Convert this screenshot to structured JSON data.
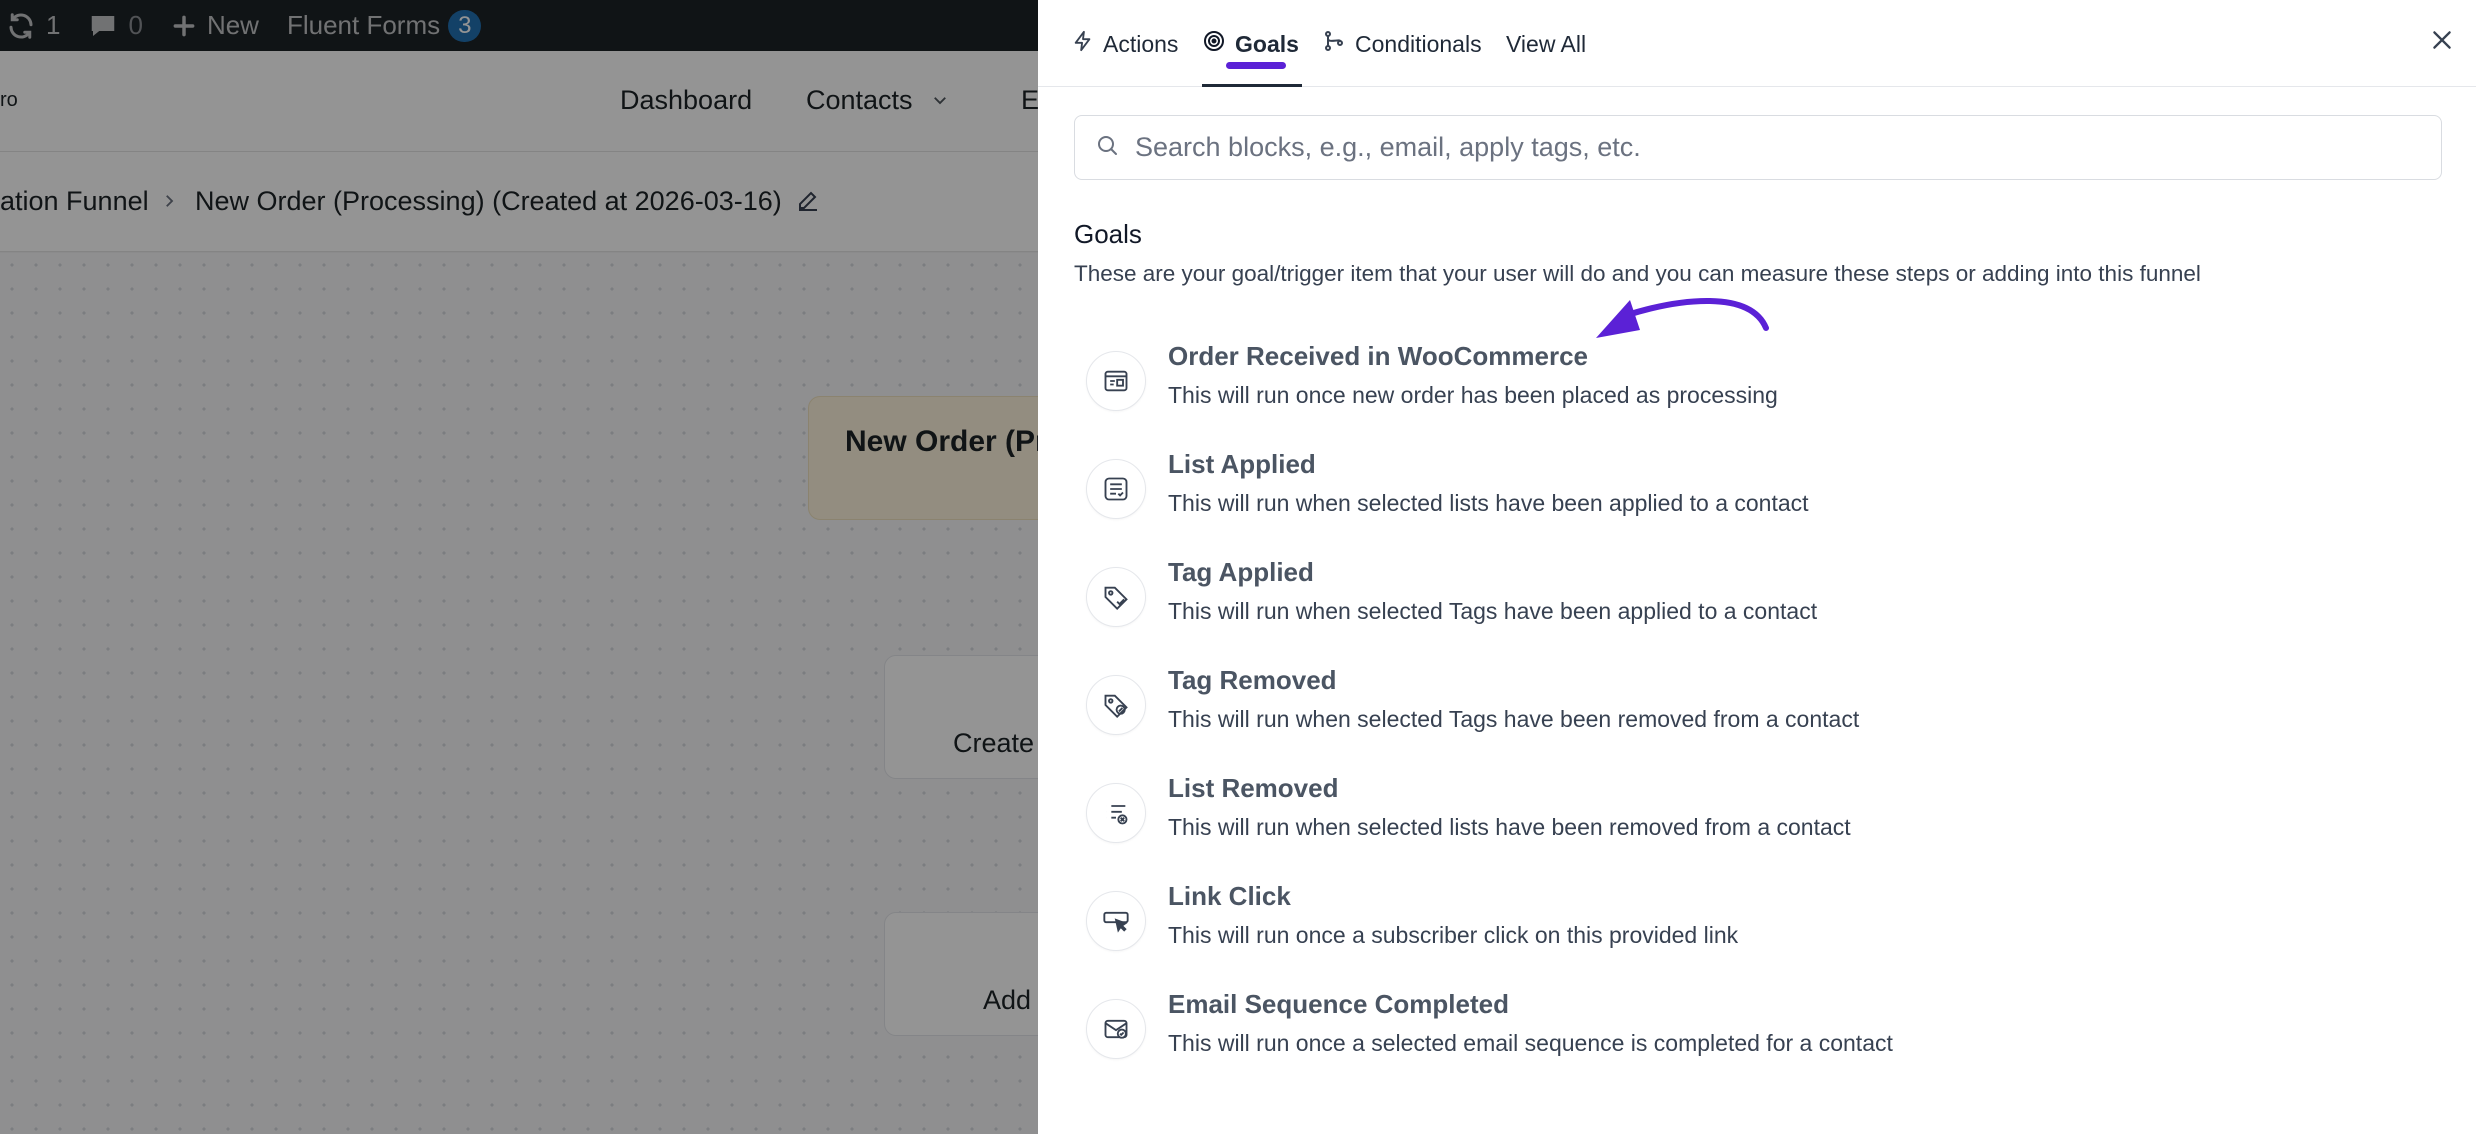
{
  "admin_bar": {
    "updates_count": "1",
    "comments_count": "0",
    "new_label": "New",
    "plugin_label": "Fluent Forms",
    "plugin_badge": "3"
  },
  "app": {
    "brand_fragment": "ro",
    "nav": {
      "dashboard": "Dashboard",
      "contacts": "Contacts",
      "partial": "E"
    },
    "breadcrumb": {
      "parent": "ation Funnel",
      "current": "New Order (Processing) (Created at 2026-03-16)"
    },
    "canvas": {
      "trigger_node": "New Order (Pr",
      "step_1": "Create",
      "step_2": "Add"
    }
  },
  "drawer": {
    "tabs": [
      {
        "label": "Actions",
        "icon": "lightning-icon"
      },
      {
        "label": "Goals",
        "icon": "target-icon",
        "active": true
      },
      {
        "label": "Conditionals",
        "icon": "branch-icon"
      },
      {
        "label": "View All"
      }
    ],
    "search": {
      "placeholder": "Search blocks, e.g., email, apply tags, etc.",
      "value": ""
    },
    "section": {
      "title": "Goals",
      "description": "These are your goal/trigger item that your user will do and you can measure these steps or adding into this funnel"
    },
    "goals": [
      {
        "title": "Order Received in WooCommerce",
        "description": "This will run once new order has been placed as processing",
        "icon": "woocommerce-order-icon"
      },
      {
        "title": "List Applied",
        "description": "This will run when selected lists have been applied to a contact",
        "icon": "list-applied-icon"
      },
      {
        "title": "Tag Applied",
        "description": "This will run when selected Tags have been applied to a contact",
        "icon": "tag-applied-icon"
      },
      {
        "title": "Tag Removed",
        "description": "This will run when selected Tags have been removed from a contact",
        "icon": "tag-removed-icon"
      },
      {
        "title": "List Removed",
        "description": "This will run when selected lists have been removed from a contact",
        "icon": "list-removed-icon"
      },
      {
        "title": "Link Click",
        "description": "This will run once a subscriber click on this provided link",
        "icon": "link-click-icon"
      },
      {
        "title": "Email Sequence Completed",
        "description": "This will run once a selected email sequence is completed for a contact",
        "icon": "email-sequence-icon"
      }
    ]
  },
  "colors": {
    "accent": "#5b21d6",
    "admin_bar": "#1d2327",
    "badge": "#2271b1",
    "trigger_node": "#fdf3dc"
  }
}
